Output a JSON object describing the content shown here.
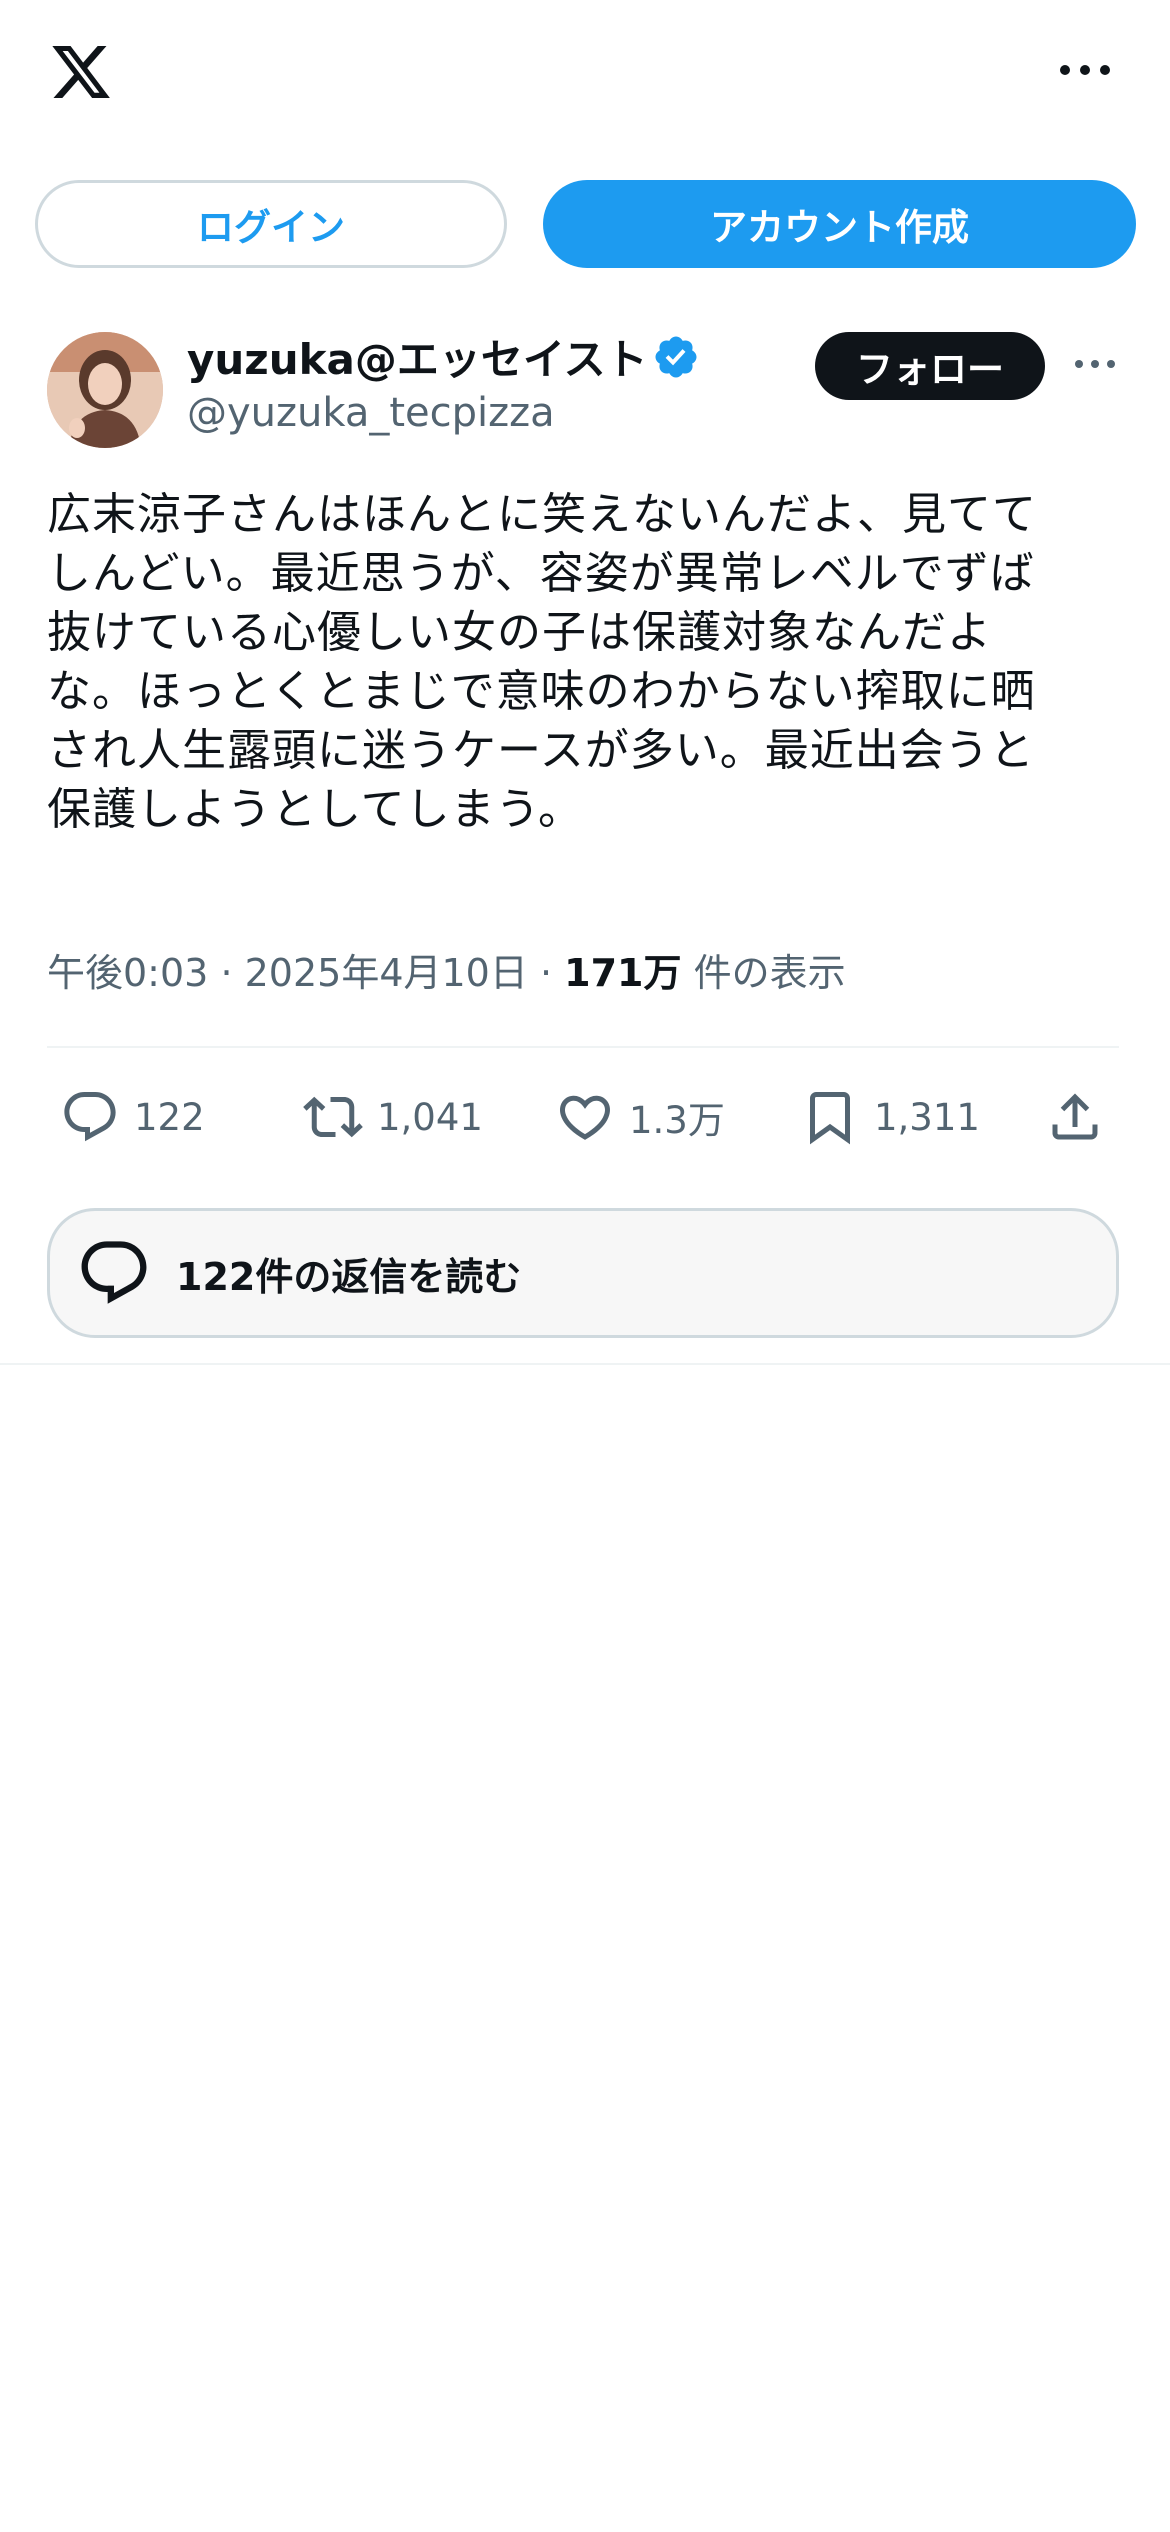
{
  "header": {
    "logo_icon": "x-logo-icon",
    "more_icon": "more-horizontal-icon"
  },
  "auth": {
    "login_label": "ログイン",
    "signup_label": "アカウント作成"
  },
  "post": {
    "author": {
      "display_name": "yuzuka@エッセイスト",
      "handle": "@yuzuka_tecpizza",
      "verified": true,
      "follow_label": "フォロー"
    },
    "text_lines": [
      "広末涼子さんはほんとに笑えないんだよ、見てて",
      "しんどい。最近思うが、容姿が異常レベルでずば",
      "抜けている心優しい女の子は保護対象なんだよ",
      "な。ほっとくとまじで意味のわからない搾取に晒",
      "され人生露頭に迷うケースが多い。最近出会うと",
      "保護しようとしてしまう。"
    ],
    "time": "午後0:03",
    "separator": "·",
    "date": "2025年4月10日",
    "views_count": "171万",
    "views_label": "件の表示",
    "actions": {
      "replies": "122",
      "reposts": "1,041",
      "likes": "1.3万",
      "bookmarks": "1,311"
    },
    "read_replies_label": "122件の返信を読む"
  },
  "colors": {
    "accent": "#1d9bf0",
    "text_primary": "#0f1419",
    "text_secondary": "#536471",
    "border": "#cfd9de",
    "follow_bg": "#0f1419"
  }
}
